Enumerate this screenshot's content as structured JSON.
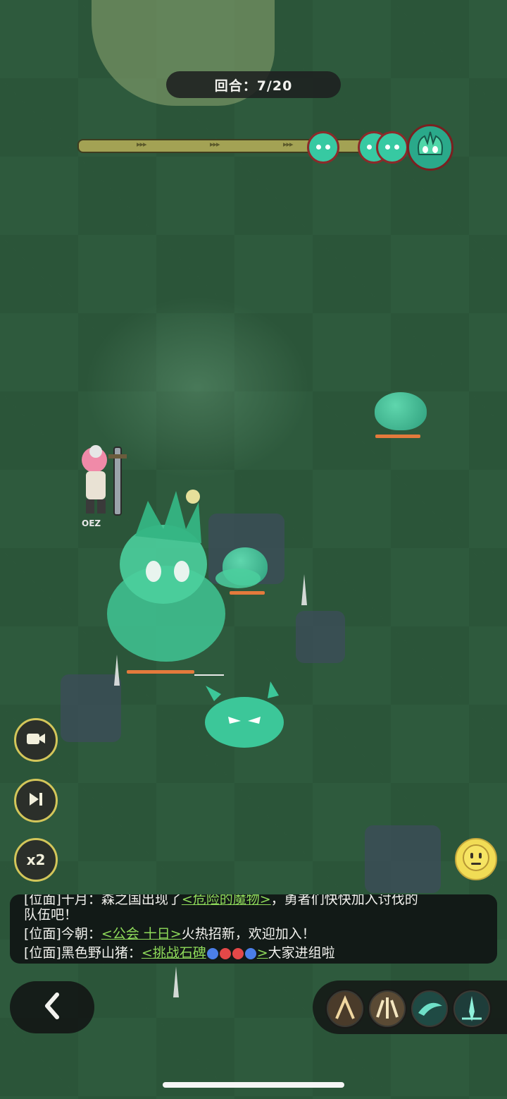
{
  "hud": {
    "round_text": "回合：7/20",
    "round_current": 7,
    "round_total": 20
  },
  "hero": {
    "name": "OEZ"
  },
  "controls": {
    "replay_icon": "camera-icon",
    "skip_icon": "skip-forward-icon",
    "speed_label": "x2",
    "emote_icon": "neutral-face-icon",
    "back_icon": "chevron-left-icon"
  },
  "chat": {
    "line1_prefix": "[位面]十月：",
    "line1_text": "森之国出现了",
    "line1_link": "<危险的魔物>",
    "line1_suffix": "，勇者们快快加入讨伐的",
    "line1_cont": "队伍吧！",
    "line2_prefix": "[位面]今朝：",
    "line2_link": "<公会 十日>",
    "line2_suffix": "火热招新，欢迎加入！",
    "line3_prefix": "[位面]黑色野山猪：",
    "line3_link_start": "<挑战石碑",
    "line3_link_end": ">",
    "line3_suffix": "大家进组啦"
  },
  "skills": [
    {
      "name": "skill-1-icon"
    },
    {
      "name": "skill-2-icon"
    },
    {
      "name": "skill-3-icon"
    },
    {
      "name": "skill-4-icon"
    }
  ],
  "colors": {
    "accent_gold": "#d3c65a",
    "link_green": "#8fdb5a",
    "hp_orange": "#e47a3c",
    "slime_green": "#37c9a2"
  }
}
